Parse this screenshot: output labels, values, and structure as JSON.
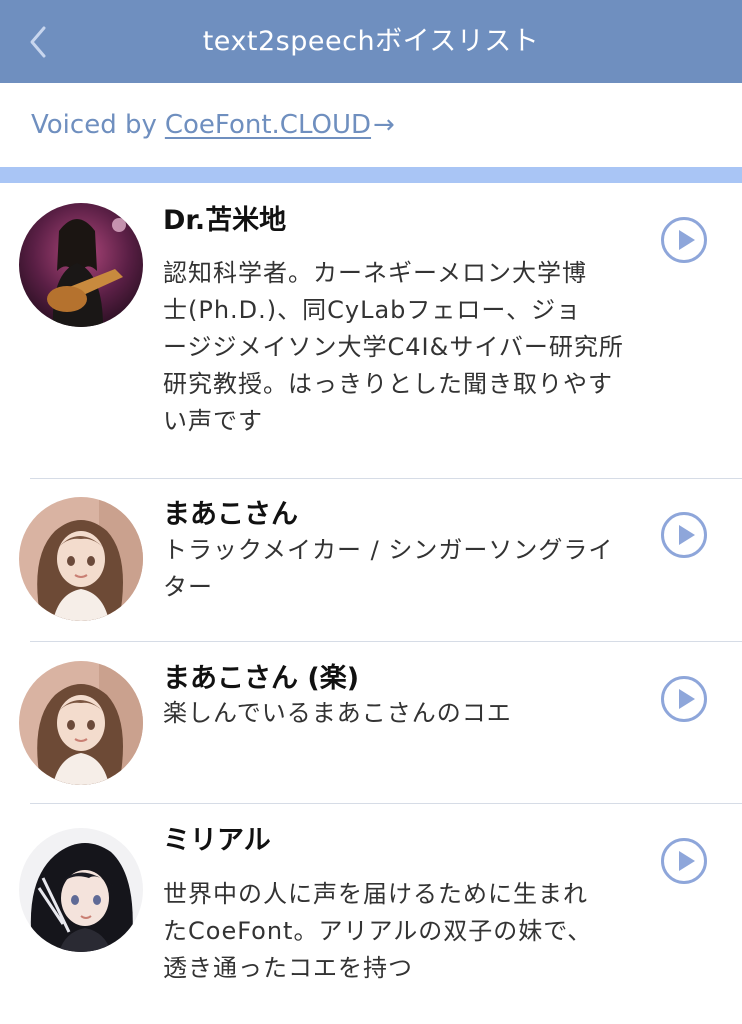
{
  "header": {
    "title": "text2speechボイスリスト",
    "back_icon": "chevron-left-icon"
  },
  "voiced": {
    "prefix": "Voiced by",
    "link": "CoeFont.CLOUD",
    "arrow": "→"
  },
  "colors": {
    "header_bg": "#6f8fbf",
    "accent": "#6f8fbf",
    "band": "#a9c5f5",
    "play": "#8ea6da"
  },
  "voices": [
    {
      "name": "Dr.苫米地",
      "description_lines": [
        "認知科学者。カーネギーメロン大学博",
        "士(Ph.D.)、同CyLabフェロー、ジョ",
        "ージジメイソン大学C4I&サイバー研究所",
        "研究教授。はっきりとした聞き取りやす",
        "い声です"
      ]
    },
    {
      "name": "まあこさん",
      "description_lines": [
        "トラックメイカー / シンガーソングライ",
        "ター"
      ]
    },
    {
      "name": "まあこさん (楽)",
      "description_lines": [
        "楽しんでいるまあこさんのコエ"
      ]
    },
    {
      "name": "ミリアル",
      "description_lines": [
        "世界中の人に声を届けるために生まれ",
        "たCoeFont。アリアルの双子の妹で、",
        "透き通ったコエを持つ"
      ]
    }
  ]
}
